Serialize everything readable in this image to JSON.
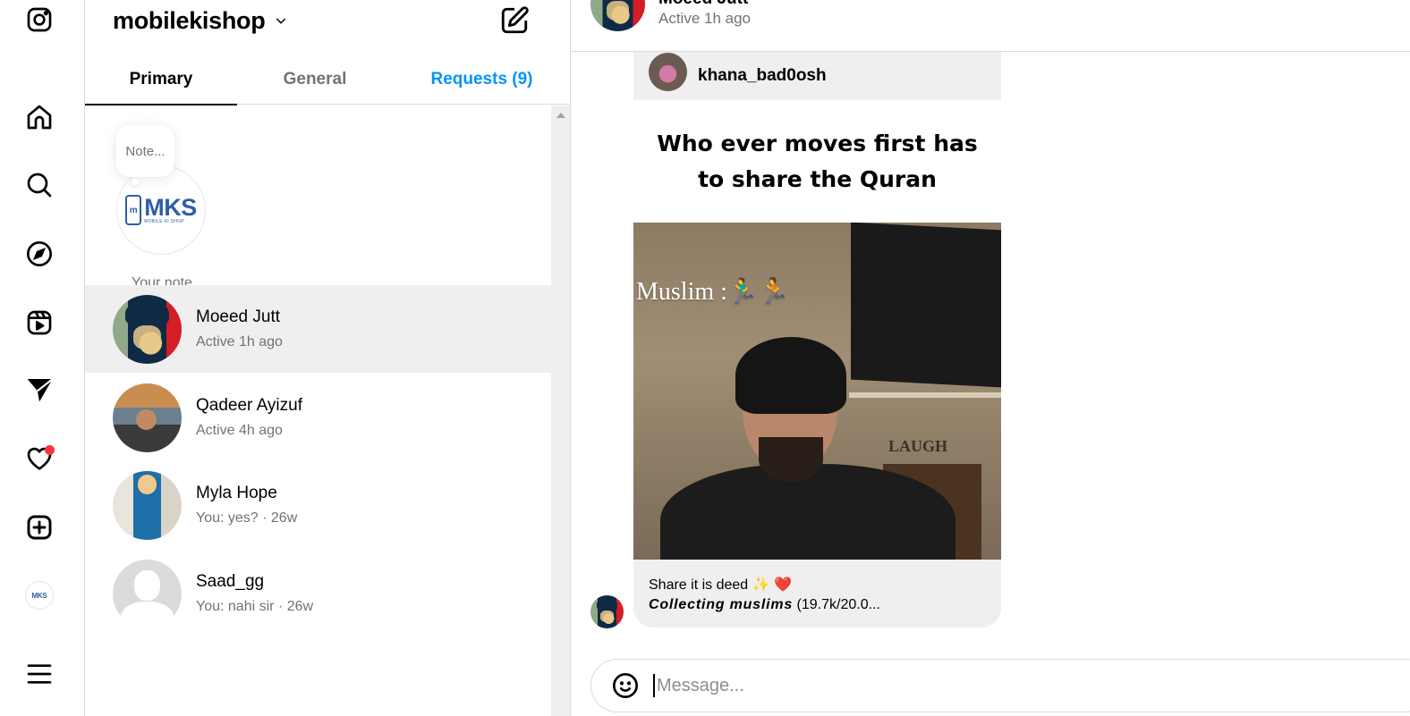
{
  "rail": {
    "items": [
      {
        "name": "instagram-logo",
        "label": "Instagram"
      },
      {
        "name": "home",
        "label": "Home"
      },
      {
        "name": "search",
        "label": "Search"
      },
      {
        "name": "explore",
        "label": "Explore"
      },
      {
        "name": "reels",
        "label": "Reels"
      },
      {
        "name": "messages",
        "label": "Messages"
      },
      {
        "name": "notifications",
        "label": "Notifications",
        "has_badge": true
      },
      {
        "name": "create",
        "label": "Create"
      },
      {
        "name": "profile",
        "label": "Profile"
      },
      {
        "name": "more",
        "label": "More"
      }
    ],
    "profile_logo_text": "MKS",
    "badge_color": "#ff3040"
  },
  "inbox": {
    "account_name": "mobilekishop",
    "tabs": [
      {
        "label": "Primary",
        "active": true
      },
      {
        "label": "General",
        "active": false
      },
      {
        "label": "Requests (9)",
        "active": false
      }
    ],
    "note": {
      "placeholder": "Note...",
      "label": "Your note",
      "logo_text": "MKS",
      "logo_subtext": "MOBILE KI SHOP",
      "logo_phone_letter": "m"
    },
    "conversations": [
      {
        "name": "Moeed Jutt",
        "subtitle": "Active 1h ago",
        "active": true
      },
      {
        "name": "Qadeer Ayizuf",
        "subtitle": "Active 4h ago",
        "active": false
      },
      {
        "name": "Myla Hope",
        "subtitle": "You: yes? · 26w",
        "active": false
      },
      {
        "name": "Saad_gg",
        "subtitle": "You: nahi sir · 26w",
        "active": false
      }
    ]
  },
  "chat": {
    "header": {
      "name": "Moeed Jutt",
      "status": "Active 1h ago"
    },
    "shared_post": {
      "owner": "khana_bad0osh",
      "headline": "Who ever moves first has to share the Quran",
      "video_overlay_text": "Muslim :🏃‍♂️🏃",
      "video_sign_text": "LAUGH",
      "caption_line1": "Share it is deed ✨ ❤️",
      "caption_bold": "Collecting muslims",
      "caption_rest": " (19.7k/20.0..."
    },
    "composer": {
      "placeholder": "Message...",
      "value": ""
    }
  },
  "colors": {
    "accent_blue": "#0095f6",
    "muted_text": "#737373",
    "active_row_bg": "#efefef",
    "divider": "#dbdbdb"
  }
}
